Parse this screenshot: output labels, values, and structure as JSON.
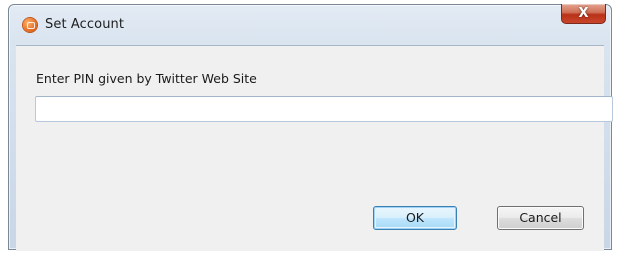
{
  "window": {
    "title": "Set Account",
    "close_label": "X",
    "app_icon": "app-icon"
  },
  "form": {
    "prompt": "Enter PIN given by Twitter Web Site",
    "pin_value": "",
    "pin_placeholder": ""
  },
  "buttons": {
    "ok_label": "OK",
    "cancel_label": "Cancel"
  },
  "colors": {
    "title_bar": "#dde6f0",
    "client_bg": "#f0f0f0",
    "close_button": "#c8452a",
    "default_button_border": "#3c7fb1"
  }
}
